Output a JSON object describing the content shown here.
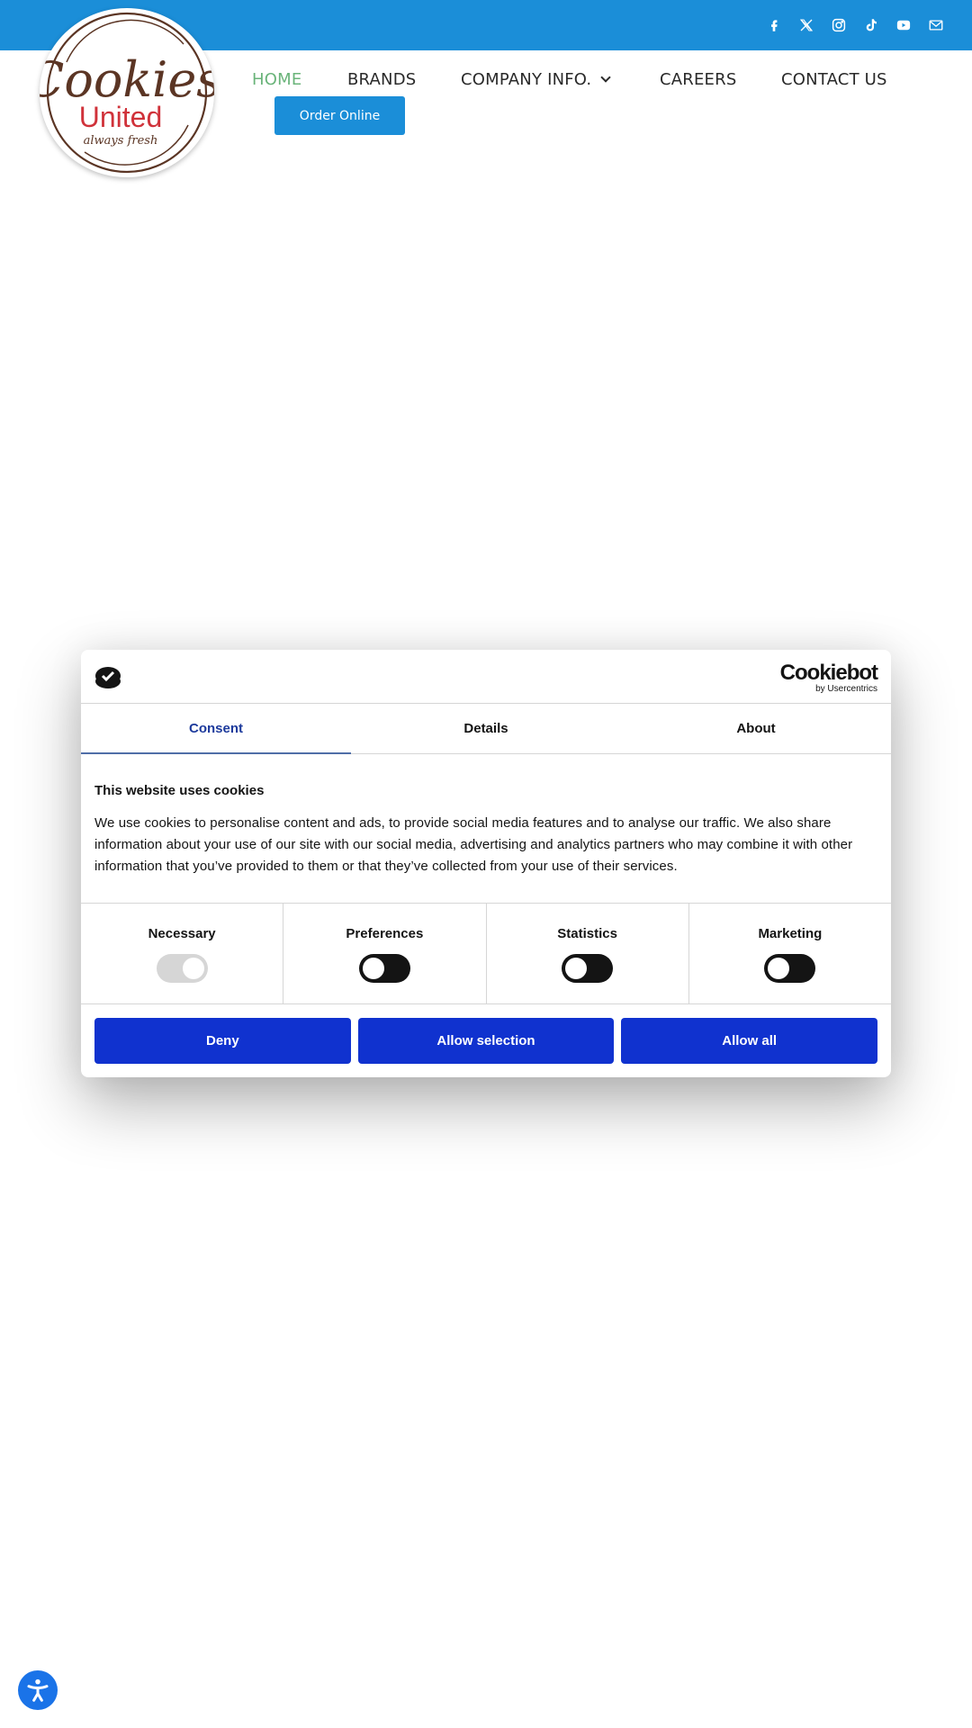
{
  "header": {
    "brand": {
      "name_line1": "Cookies",
      "name_line2": "United",
      "tagline": "always fresh"
    },
    "social_icons": [
      {
        "name": "facebook-icon",
        "label": "Facebook"
      },
      {
        "name": "x-twitter-icon",
        "label": "X"
      },
      {
        "name": "instagram-icon",
        "label": "Instagram"
      },
      {
        "name": "tiktok-icon",
        "label": "TikTok"
      },
      {
        "name": "youtube-icon",
        "label": "YouTube"
      },
      {
        "name": "email-icon",
        "label": "Email"
      }
    ],
    "nav": [
      {
        "label": "HOME",
        "active": true
      },
      {
        "label": "BRANDS",
        "active": false
      },
      {
        "label": "COMPANY INFO.",
        "active": false,
        "dropdown": true
      },
      {
        "label": "CAREERS",
        "active": false
      },
      {
        "label": "CONTACT US",
        "active": false
      }
    ],
    "order_button": "Order Online",
    "colors": {
      "topbar": "#1b8ed8",
      "nav_active": "#6ab47a",
      "nav_text": "#2a2a2a"
    }
  },
  "consent": {
    "brand_main": "Cookiebot",
    "brand_sub": "by Usercentrics",
    "tabs": [
      {
        "label": "Consent",
        "active": true
      },
      {
        "label": "Details",
        "active": false
      },
      {
        "label": "About",
        "active": false
      }
    ],
    "title": "This website uses cookies",
    "text": "We use cookies to personalise content and ads, to provide social media features and to analyse our traffic. We also share information about your use of our site with our social media, advertising and analytics partners who may combine it with other information that you’ve provided to them or that they’ve collected from your use of their services.",
    "categories": [
      {
        "label": "Necessary",
        "enabled": true,
        "locked": true
      },
      {
        "label": "Preferences",
        "enabled": false,
        "locked": false
      },
      {
        "label": "Statistics",
        "enabled": false,
        "locked": false
      },
      {
        "label": "Marketing",
        "enabled": false,
        "locked": false
      }
    ],
    "buttons": {
      "deny": "Deny",
      "allow_selection": "Allow selection",
      "allow_all": "Allow all"
    },
    "colors": {
      "button": "#1032cf",
      "active_tab": "#1d3a9c"
    }
  },
  "accessibility": {
    "label": "Accessibility"
  }
}
